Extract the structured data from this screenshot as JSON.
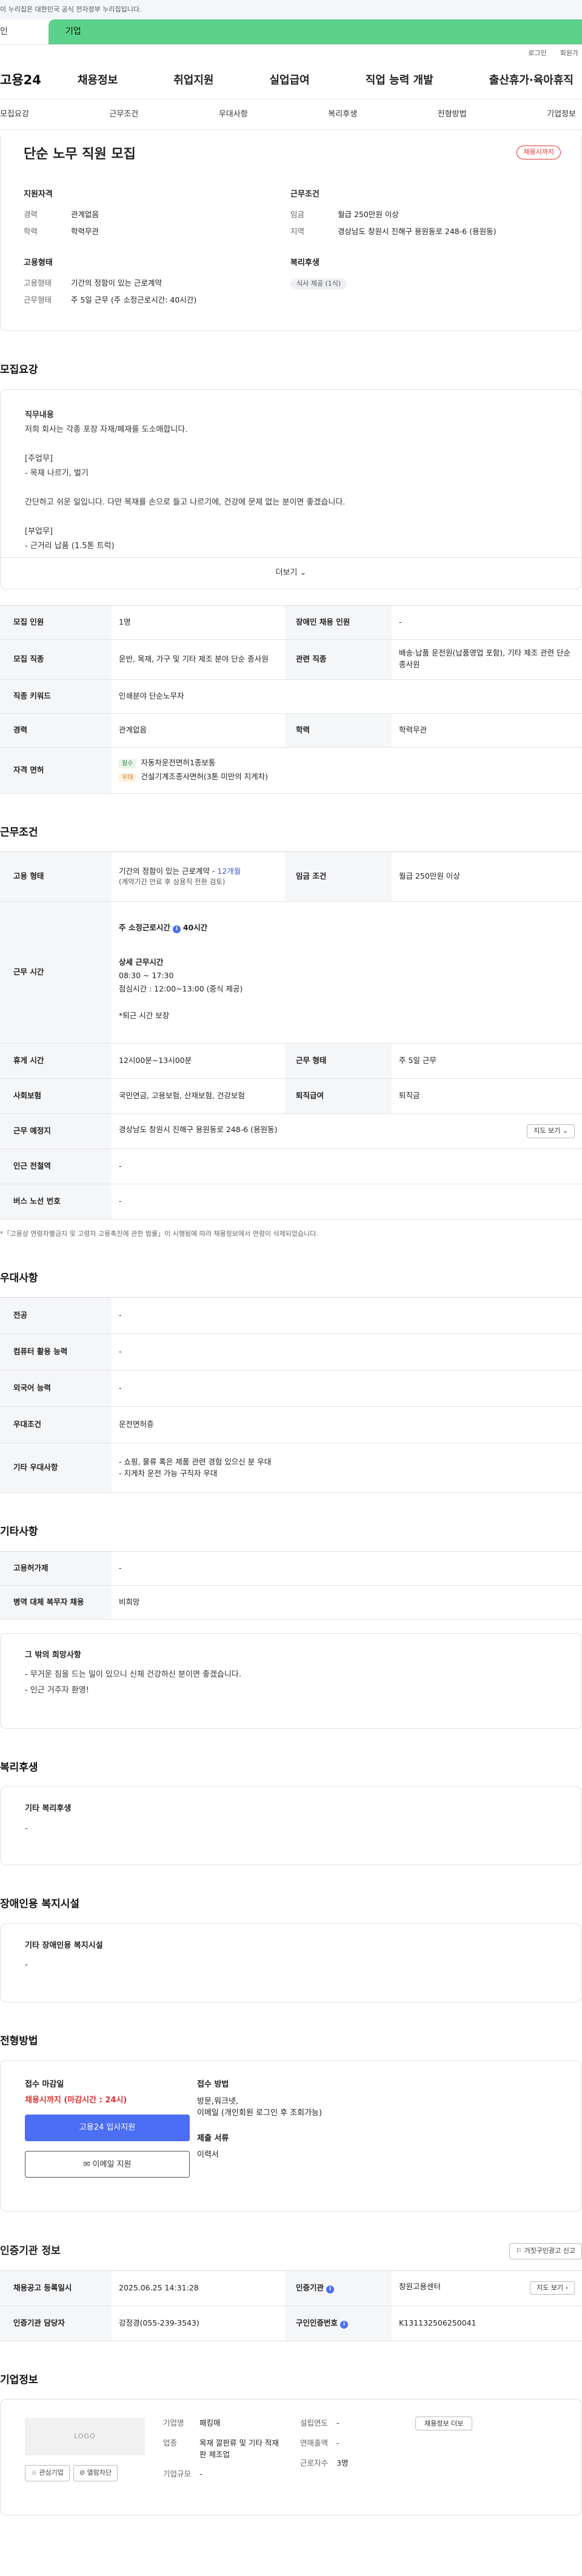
{
  "gov_notice": "이 누리집은 대한민국 공식 전자정부 누리집입니다.",
  "site_tabs": [
    "인",
    "기업"
  ],
  "util_links": [
    "로그인",
    "회원가"
  ],
  "logo": "고용24",
  "gnb": [
    "채용정보",
    "취업지원",
    "실업급여",
    "직업 능력 개발",
    "출산휴가·육아휴직"
  ],
  "snb": [
    "모집요강",
    "근무조건",
    "우대사항",
    "복리후생",
    "전형방법",
    "기업정보"
  ],
  "header": {
    "title": "단순 노무 직원 모집",
    "status_badge": "채용시까지",
    "qual_title": "지원자격",
    "qual": [
      {
        "k": "경력",
        "v": "관계없음"
      },
      {
        "k": "학력",
        "v": "학력무관"
      }
    ],
    "cond_title": "근무조건",
    "cond": [
      {
        "k": "임금",
        "v": "월급 250만원 이상"
      },
      {
        "k": "지역",
        "v": "경상남도 창원시 진해구 용원동로 248-6 (용원동)"
      }
    ],
    "emp_title": "고용형태",
    "emp": [
      {
        "k": "고용형태",
        "v": "기간의 정함이 있는 근로계약"
      },
      {
        "k": "근무형태",
        "v": "주 5일 근무 (주 소정근로시간: 40시간)"
      }
    ],
    "welfare_title": "복리후생",
    "welfare_chip": "식사 제공 (1식)"
  },
  "recruit": {
    "title": "모집요강",
    "desc_lines": [
      "직무내용",
      "저희 회사는 각종 포장 자재/폐재를  도소매합니다.",
      "",
      "[주업무]",
      "- 목재 나르기, 벌기",
      "",
      "간단하고 쉬운 일입니다. 다만 목재를 손으로 들고 나르기에, 건강에 문제 없는 분이면 좋겠습니다.",
      "",
      "[부업무]",
      "- 근거리 납품 (1.5톤 트럭)"
    ],
    "more": "더보기",
    "rows": {
      "count_l": "모집 인원",
      "count_v": "1명",
      "disabled_l": "장애인 채용 인원",
      "disabled_v": "-",
      "job_l": "모집 직종",
      "job_v": "운반, 목재, 가구 및 기타 제조 분야 단순 종사원",
      "rel_l": "관련 직종",
      "rel_v": "배송·납품 운전원(납품영업 포함), 기타 제조 관련 단순 종사원",
      "kw_l": "직종 키워드",
      "kw_v": "인쇄분야 단순노무자",
      "exp_l": "경력",
      "exp_v": "관계없음",
      "edu_l": "학력",
      "edu_v": "학력무관",
      "lic_l": "자격 면허",
      "lic": [
        {
          "tag": "필수",
          "v": "자동차운전면허1종보통"
        },
        {
          "tag": "우대",
          "v": "건설기계조종사면허(3톤 미만의 지게차)"
        }
      ]
    }
  },
  "work": {
    "title": "근무조건",
    "emp_l": "고용 형태",
    "emp_v1": "기간의 정함이 있는 근로계약 -",
    "emp_link": "12개월",
    "emp_v2": "(계약기간 만료 후 상용직 전환 검토)",
    "wage_l": "임금 조건",
    "wage_v": "월급 250만원 이상",
    "hours_l": "근무 시간",
    "hours_head": "주 소정근로시간",
    "hours_head2": "40시간",
    "hours_lines": [
      "상세 근무시간",
      "08:30 ~ 17:30",
      "점심시간 : 12:00~13:00 (중식 제공)",
      "",
      "*퇴근 시간 보장"
    ],
    "break_l": "휴게 시간",
    "break_v": "12시00분~13시00분",
    "type_l": "근무 형태",
    "type_v": "주 5일 근무",
    "ins_l": "사회보험",
    "ins_v": "국민연금, 고용보험, 산재보험, 건강보험",
    "sev_l": "퇴직급여",
    "sev_v": "퇴직금",
    "place_l": "근무 예정지",
    "place_v": "경상남도 창원시 진해구 용원동로 248-6 (용원동)",
    "map_btn": "지도 보기",
    "subway_l": "인근 전철역",
    "subway_v": "-",
    "bus_l": "버스 노선 번호",
    "bus_v": "-",
    "note": "*「고용상 연령차별금지 및 고령자 고용촉진에 관한 법률」이 시행됨에 따라 채용정보에서 연령이 삭제되었습니다."
  },
  "pref": {
    "title": "우대사항",
    "rows": [
      {
        "k": "전공",
        "v": [
          "-"
        ]
      },
      {
        "k": "컴퓨터 활용 능력",
        "v": [
          "-"
        ]
      },
      {
        "k": "외국어 능력",
        "v": [
          "-"
        ]
      },
      {
        "k": "우대조건",
        "v": [
          "운전면허증"
        ]
      },
      {
        "k": "기타 우대사항",
        "v": [
          "- 쇼핑, 물류 혹은 제품 관련 경험 있으신 분 우대",
          "- 지게차 운전 가능 구직자 우대"
        ]
      }
    ]
  },
  "etc": {
    "title": "기타사항",
    "rows": [
      {
        "k": "고용허가제",
        "v": "-"
      },
      {
        "k": "병역 대체 복무자 채용",
        "v": "비희망"
      }
    ],
    "card_t": "그 밖의 희망사항",
    "card_lines": [
      "- 무거운 짐을 드는 일이 있으니 신체 건강하신 분이면 좋겠습니다.",
      "- 인근 거주자 환영!"
    ]
  },
  "welfare": {
    "title": "복리후생",
    "card_t": "기타 복리후생",
    "card_v": "-"
  },
  "disabled": {
    "title": "장애인용 복지시설",
    "card_t": "기타 장애인용 복지시설",
    "card_v": "-"
  },
  "apply": {
    "title": "전형방법",
    "deadline_t": "접수 마감일",
    "deadline_v": "채용시까지 (마감시간 : 24시)",
    "btn_apply": "고용24 입사지원",
    "btn_email": "이메일 지원",
    "method_t": "접수 방법",
    "method_lines": [
      "방문,워크넷,",
      "이메일 (개인회원 로그인 후 조회가능)"
    ],
    "docs_t": "제출 서류",
    "docs_v": "이력서"
  },
  "agency": {
    "title": "인증기관 정보",
    "report_btn": "거짓구인광고 신고",
    "reg_l": "채용공고 등록일시",
    "reg_v": "2025.06.25 14:31:28",
    "org_l": "인증기관",
    "org_v": "창원고용센터",
    "map_btn": "지도 보기",
    "mgr_l": "인증기관 담당자",
    "mgr_v": "강정경(055-239-3543)",
    "no_l": "구인인증번호",
    "no_v": "K131132506250041"
  },
  "company": {
    "title": "기업정보",
    "logo_text": "LOGO",
    "btn_fav": "관심기업",
    "btn_block": "열람차단",
    "rows1": [
      {
        "k": "기업명",
        "v": "패킹매"
      },
      {
        "k": "업종",
        "v": "목재 깔판류 및 기타 적재판 제조업"
      },
      {
        "k": "기업규모",
        "v": "-"
      }
    ],
    "rows2": [
      {
        "k": "설립연도",
        "v": "-"
      },
      {
        "k": "연매출액",
        "v": "-"
      },
      {
        "k": "근로자수",
        "v": "3명"
      }
    ],
    "btn_list": "채용정보 더보"
  }
}
